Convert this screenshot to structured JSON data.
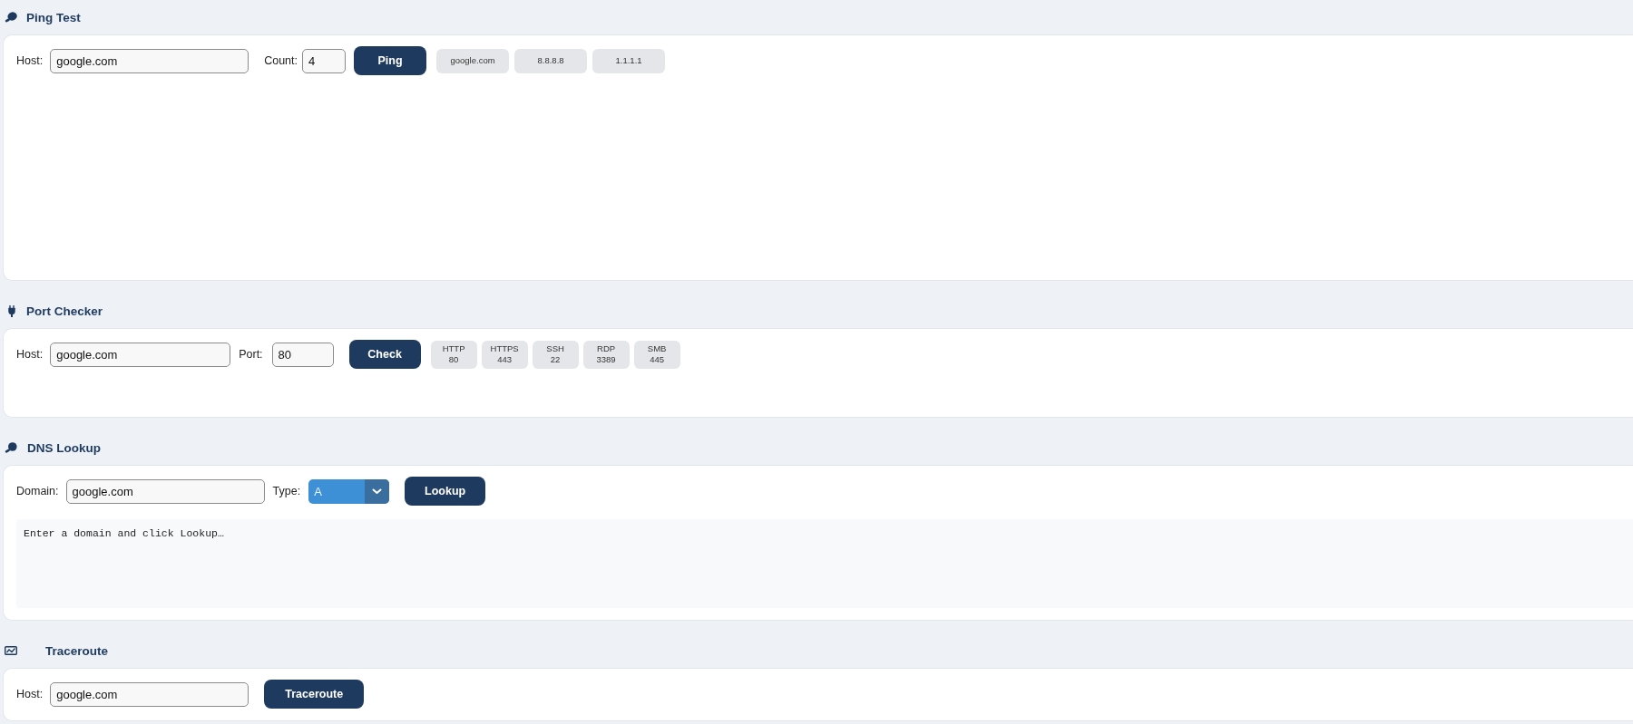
{
  "ping_test": {
    "title": "Ping Test",
    "host": {
      "label": "Host:",
      "value": "google.com"
    },
    "count": {
      "label": "Count:",
      "value": "4"
    },
    "button": "Ping",
    "presets": [
      "google.com",
      "8.8.8.8",
      "1.1.1.1"
    ]
  },
  "port_checker": {
    "title": "Port Checker",
    "host": {
      "label": "Host:",
      "value": "google.com"
    },
    "port": {
      "label": "Port:",
      "value": "80"
    },
    "button": "Check",
    "presets": [
      {
        "name": "HTTP",
        "port": "80"
      },
      {
        "name": "HTTPS",
        "port": "443"
      },
      {
        "name": "SSH",
        "port": "22"
      },
      {
        "name": "RDP",
        "port": "3389"
      },
      {
        "name": "SMB",
        "port": "445"
      }
    ]
  },
  "dns_lookup": {
    "title": "DNS Lookup",
    "domain": {
      "label": "Domain:",
      "value": "google.com"
    },
    "type": {
      "label": "Type:",
      "value": "A"
    },
    "button": "Lookup",
    "output": "Enter a domain and click Lookup…"
  },
  "traceroute": {
    "title": "Traceroute",
    "host": {
      "label": "Host:",
      "value": "google.com"
    },
    "button": "Traceroute"
  }
}
